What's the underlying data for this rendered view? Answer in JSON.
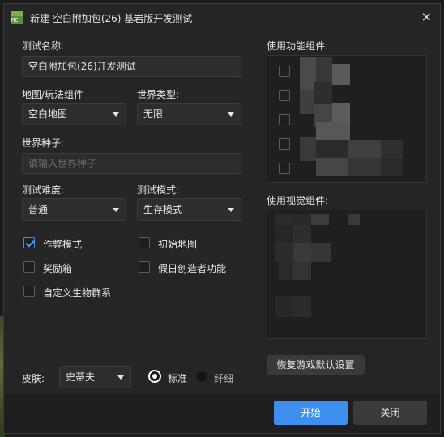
{
  "window": {
    "title": "新建 空白附加包(26) 基岩版开发测试",
    "icon": "app-icon",
    "close_symbol": "×",
    "icon_text": "MC"
  },
  "form": {
    "test_name_label": "测试名称:",
    "test_name_value": "空白附加包(26)开发测试",
    "map_label": "地图/玩法组件",
    "map_value": "空白地图",
    "world_type_label": "世界类型:",
    "world_type_value": "无限",
    "seed_label": "世界种子:",
    "seed_placeholder": "请输入世界种子",
    "difficulty_label": "测试难度:",
    "difficulty_value": "普通",
    "mode_label": "测试模式:",
    "mode_value": "生存模式"
  },
  "options": [
    {
      "label": "作弊模式",
      "checked": true
    },
    {
      "label": "初始地图",
      "checked": false
    },
    {
      "label": "奖励箱",
      "checked": false
    },
    {
      "label": "假日创造者功能",
      "checked": false
    },
    {
      "label": "自定义生物群系",
      "checked": false
    }
  ],
  "skin": {
    "label": "皮肤:",
    "value": "史蒂夫",
    "radio_standard": "标准",
    "radio_slim": "纤细",
    "selected": "标准"
  },
  "right": {
    "function_label": "使用功能组件:",
    "visual_label": "使用视觉组件:",
    "reset_button": "恢复游戏默认设置"
  },
  "footer": {
    "start_button": "开始",
    "close_button": "关闭"
  },
  "colors": {
    "accent": "#3d8ff0",
    "background": "#252526",
    "panel": "#1f1f21"
  }
}
